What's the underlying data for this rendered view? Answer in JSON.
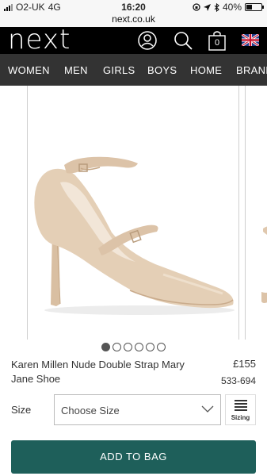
{
  "status_bar": {
    "carrier": "O2-UK",
    "network": "4G",
    "time": "16:20",
    "url": "next.co.uk",
    "battery": "40%",
    "battery_level": 0.4
  },
  "header": {
    "logo": "next",
    "bag_count": "0",
    "icons": [
      "account-icon",
      "search-icon",
      "bag-icon",
      "uk-flag-icon"
    ]
  },
  "nav": {
    "items": [
      "WOMEN",
      "MEN",
      "GIRLS",
      "BOYS",
      "HOME",
      "BRANDS"
    ]
  },
  "gallery": {
    "image_count": 6,
    "active_index": 0
  },
  "product": {
    "name": "Karen Millen Nude Double Strap Mary Jane Shoe",
    "price": "£155",
    "code": "533-694"
  },
  "size": {
    "label": "Size",
    "placeholder": "Choose Size",
    "sizing_label": "Sizing"
  },
  "actions": {
    "add_to_bag": "ADD TO BAG"
  },
  "colors": {
    "header_bg": "#000000",
    "nav_bg": "#333333",
    "button_bg": "#1e5f5a"
  }
}
